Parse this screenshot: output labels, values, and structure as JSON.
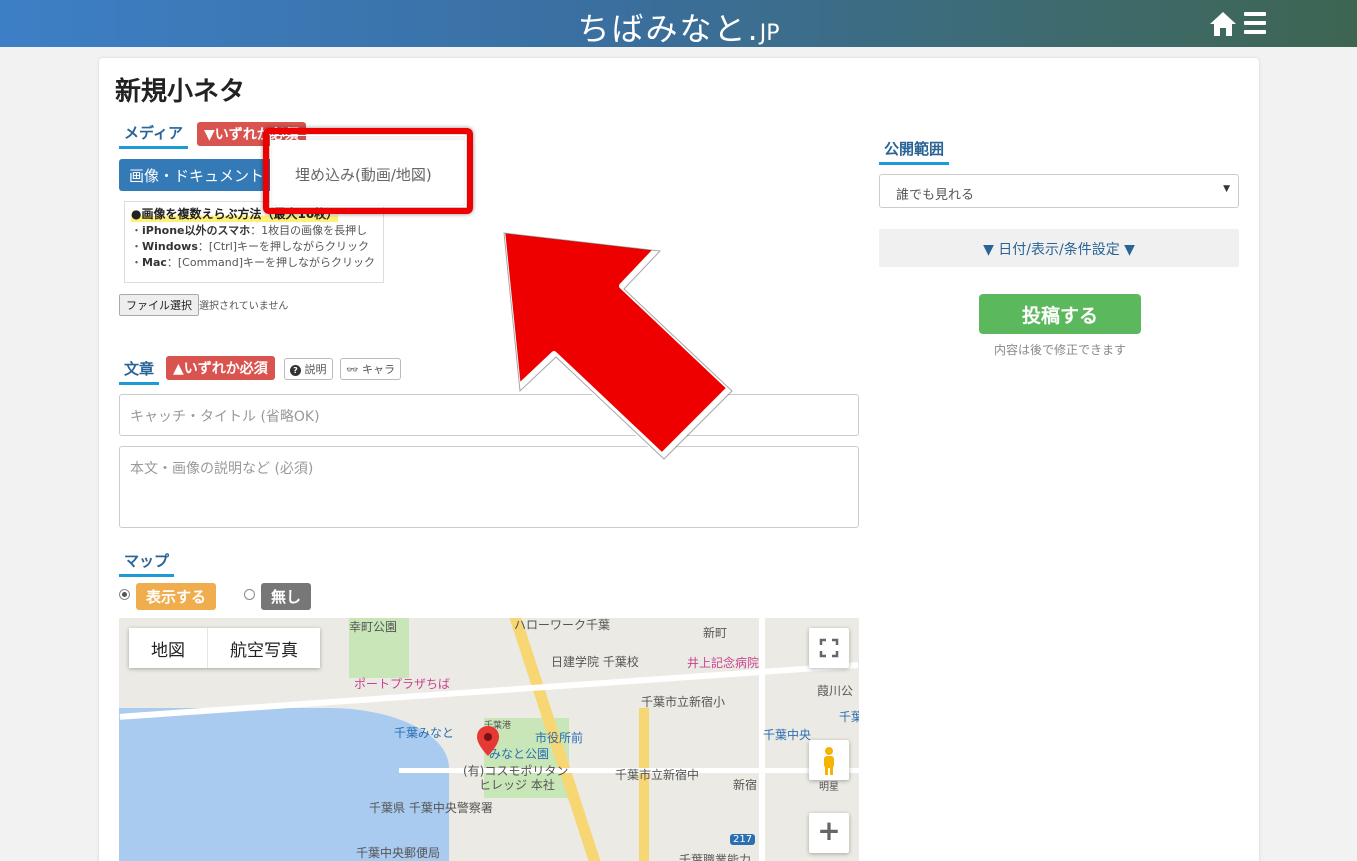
{
  "header": {
    "brand_main": "ちばみなと.",
    "brand_jp": "JP",
    "home_icon": "home-icon",
    "menu_icon": "hamburger-menu-icon"
  },
  "page": {
    "title": "新規小ネタ"
  },
  "media": {
    "label": "メディア",
    "required_badge": "▼いずれか必須",
    "upload_button": "画像・ドキュメント",
    "dropdown_option": "埋め込み(動画/地図)",
    "hint_title": "●画像を複数えらぶ方法（最大10枚）",
    "hint_line1_prefix": "・",
    "hint_line1_bold": "iPhone以外のスマホ",
    "hint_line1_rest": "：1枚目の画像を長押し",
    "hint_line2_prefix": "・",
    "hint_line2_bold": "Windows",
    "hint_line2_rest": "：[Ctrl]キーを押しながらクリック",
    "hint_line3_prefix": "・",
    "hint_line3_bold": "Mac",
    "hint_line3_rest": "：[Command]キーを押しながらクリック",
    "file_button": "ファイル選択",
    "file_status": "選択されていません"
  },
  "text": {
    "label": "文章",
    "required_badge": "▲いずれか必須",
    "help_button": "説明",
    "chara_button": "キャラ",
    "catch_placeholder": "キャッチ・タイトル (省略OK)",
    "body_placeholder": "本文・画像の説明など (必須)"
  },
  "map": {
    "label": "マップ",
    "show_option": "表示する",
    "none_option": "無し",
    "type_map": "地図",
    "type_aerial": "航空写真",
    "places": {
      "saiwaicho_park": "幸町公園",
      "hellowork": "ハローワーク千葉",
      "shinmachi": "新町",
      "nikken": "日建学院 千葉校",
      "inoue": "井上記念病院",
      "port_plaza": "ポートプラザちば",
      "shinjuku_es": "千葉市立新宿小",
      "chiba_minato": "千葉みなと",
      "chiba_port": "千葉港",
      "shiyakusho": "市役所前",
      "minato_park": "みなと公園",
      "cosmo": "(有)コスモポリタン",
      "cosmo2": "ヒレッジ 本社",
      "shinjuku_jhs": "千葉市立新宿中",
      "shinjuku": "新宿",
      "chiba_chuo": "千葉中央",
      "police": "千葉県 千葉中央警察署",
      "post": "千葉中央郵便局",
      "route": "217",
      "shokugyo": "千葉職業能力",
      "sakuragawa": "葭川公",
      "chiba_r": "千葉",
      "edge": "明星"
    }
  },
  "sidebar": {
    "visibility_label": "公開範囲",
    "visibility_value": "誰でも見れる",
    "conditions_button": "▼ 日付/表示/条件設定 ▼",
    "post_button": "投稿する",
    "post_note": "内容は後で修正できます"
  },
  "colors": {
    "accent_blue": "#337ab7",
    "required_red": "#d9534f",
    "post_green": "#5cb85c",
    "annotation_red": "#ee0000"
  }
}
